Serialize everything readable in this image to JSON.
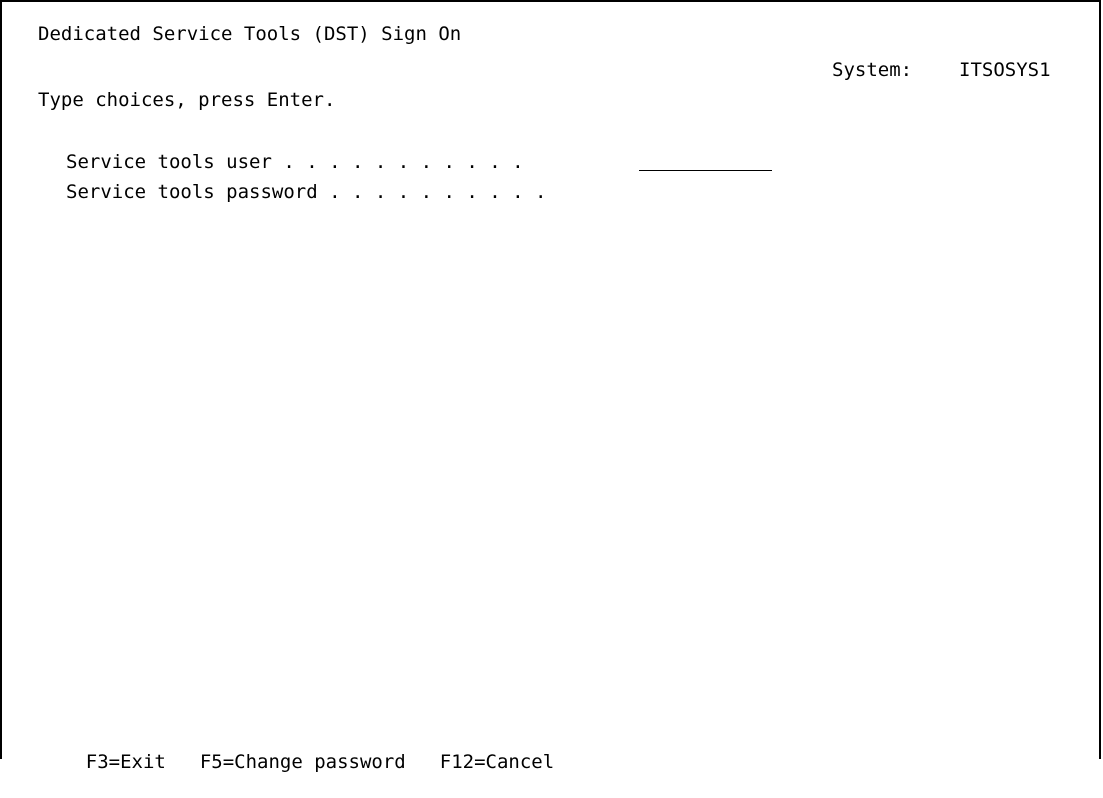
{
  "screen": {
    "title": "Dedicated Service Tools (DST) Sign On",
    "system_label": "System:",
    "system_name": "ITSOSYS1",
    "instructions": "Type choices, press Enter."
  },
  "fields": {
    "user_label": "Service tools user . . . . . . . . . . .",
    "user_value": "",
    "password_label": "Service tools password . . . . . . . . . .",
    "password_value": ""
  },
  "function_keys": {
    "exit": "F3=Exit",
    "change_password": "F5=Change password",
    "cancel": "F12=Cancel"
  }
}
